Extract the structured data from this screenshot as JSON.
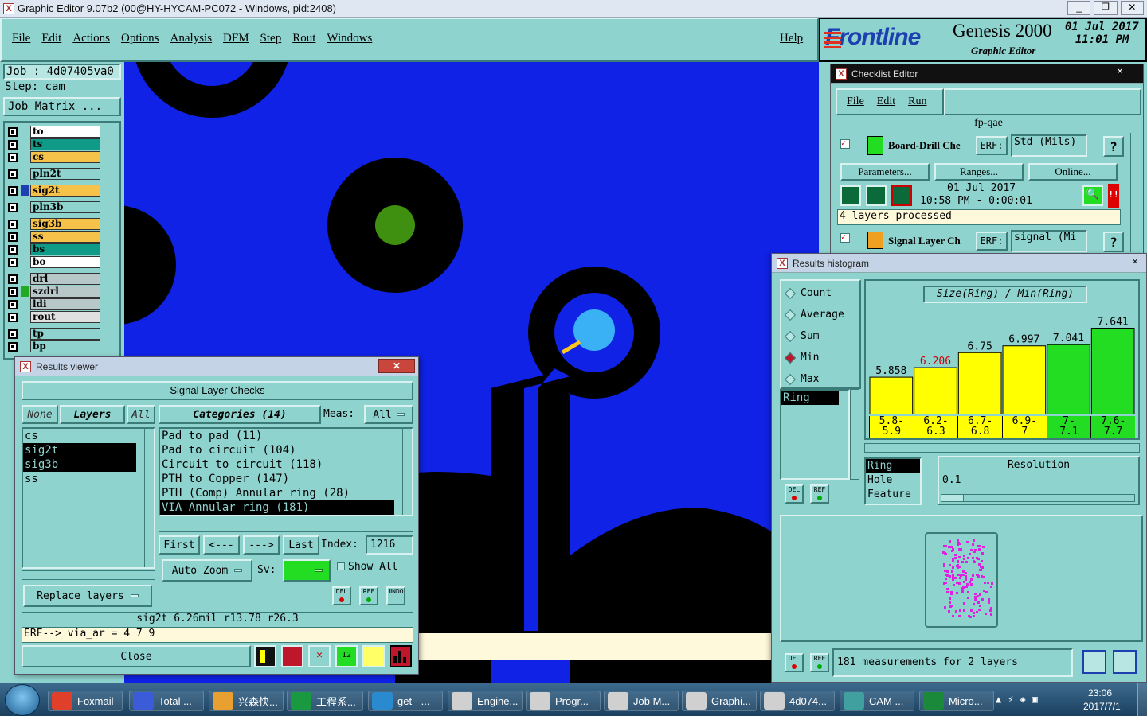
{
  "app": {
    "title": "Graphic Editor 9.07b2 (00@HY-HYCAM-PC072 - Windows, pid:2408)",
    "help": "Help"
  },
  "menu": [
    "File",
    "Edit",
    "Actions",
    "Options",
    "Analysis",
    "DFM",
    "Step",
    "Rout",
    "Windows"
  ],
  "brand": {
    "logo": "Frontline",
    "product": "Genesis 2000",
    "subtitle": "Graphic Editor",
    "date": "01 Jul 2017",
    "time": "11:01 PM"
  },
  "job": {
    "job": "Job : 4d07405va0",
    "step": "Step: cam",
    "matrix": "Job Matrix ..."
  },
  "layers": [
    {
      "name": "to",
      "color": "#ffffff"
    },
    {
      "name": "ts",
      "color": "#0f9b88"
    },
    {
      "name": "cs",
      "color": "#f7c24a"
    },
    {
      "name": "pln2t",
      "color": "#8fd3cf"
    },
    {
      "name": "sig2t",
      "color": "#f7c24a"
    },
    {
      "name": "pln3b",
      "color": "#8fd3cf"
    },
    {
      "name": "sig3b",
      "color": "#f7c24a"
    },
    {
      "name": "ss",
      "color": "#f7c24a"
    },
    {
      "name": "bs",
      "color": "#0f9b88"
    },
    {
      "name": "bo",
      "color": "#ffffff"
    },
    {
      "name": "drl",
      "color": "#b8c8c8"
    },
    {
      "name": "szdrl",
      "color": "#b8c8c8"
    },
    {
      "name": "ldi",
      "color": "#b8c8c8"
    },
    {
      "name": "rout",
      "color": "#e0e0e0"
    },
    {
      "name": "tp",
      "color": "#8fd3cf"
    },
    {
      "name": "bp",
      "color": "#8fd3cf"
    }
  ],
  "results_viewer": {
    "title": "Results viewer",
    "header": "Signal Layer Checks",
    "none": "None",
    "layers_label": "Layers",
    "all": "All",
    "categories_label": "Categories (14)",
    "meas_label": "Meas:",
    "meas_value": "All",
    "layer_list": [
      "cs",
      "sig2t",
      "sig3b",
      "ss"
    ],
    "categories": [
      "Pad to pad (11)",
      "Pad to circuit (104)",
      "Circuit to circuit (118)",
      "PTH to Copper (147)",
      "PTH (Comp) Annular ring (28)",
      "VIA Annular ring (181)"
    ],
    "first": "First",
    "prev": "<---",
    "next": "--->",
    "last": "Last",
    "index_label": "Index:",
    "index_value": "1216",
    "autozoom": "Auto Zoom",
    "sv_label": "Sv:",
    "show_all": "Show All",
    "replace": "Replace layers",
    "status": "sig2t  6.26mil  r13.78  r26.3",
    "erf": "ERF--> via_ar = 4 7 9",
    "close": "Close",
    "del": "DEL",
    "ref": "REF",
    "undo": "UNDO"
  },
  "checklist": {
    "title": "Checklist Editor",
    "menu": [
      "File",
      "Edit",
      "Run"
    ],
    "name": "fp-qae",
    "item1": "Board-Drill Che",
    "erf": "ERF:",
    "erf1": "Std (Mils)",
    "q": "?",
    "params": "Parameters...",
    "ranges": "Ranges...",
    "online": "Online...",
    "date": "01  Jul  2017",
    "time": "10:58  PM  -  0:00:01",
    "processed": "4 layers processed",
    "item2": "Signal Layer Ch",
    "erf2": "signal (Mi"
  },
  "histogram": {
    "title": "Results histogram",
    "modes": [
      "Count",
      "Average",
      "Sum",
      "Min",
      "Max"
    ],
    "selected_mode": "Min",
    "plot_title": "Size(Ring) / Min(Ring)",
    "list": [
      "Ring"
    ],
    "feature_list": [
      "Ring",
      "Hole",
      "Feature"
    ],
    "resolution_label": "Resolution",
    "resolution": "0.1",
    "footer": "181 measurements for 2 layers",
    "del": "DEL",
    "ref": "REF"
  },
  "chart_data": {
    "type": "bar",
    "categories": [
      "5.8-5.9",
      "6.2-6.3",
      "6.7-6.8",
      "6.9-7",
      "7-7.1",
      "7.6-7.7"
    ],
    "values": [
      5.858,
      6.206,
      6.75,
      6.997,
      7.041,
      7.641
    ],
    "colors": [
      "#ffff00",
      "#ffff00",
      "#ffff00",
      "#ffff00",
      "#22dd22",
      "#22dd22"
    ],
    "label_colors": [
      "#000000",
      "#d00000",
      "#000000",
      "#000000",
      "#000000",
      "#000000"
    ],
    "value_labels": [
      "5.858",
      "6.206",
      "6.75",
      "6.997",
      "7.041",
      "7.641"
    ],
    "bin_labels": [
      [
        "5.8-",
        "5.9"
      ],
      [
        "6.2-",
        "6.3"
      ],
      [
        "6.7-",
        "6.8"
      ],
      [
        "6.9-",
        "7"
      ],
      [
        "7-",
        "7.1"
      ],
      [
        "7.6-",
        "7.7"
      ]
    ],
    "title": "Size(Ring) / Min(Ring)"
  },
  "taskbar": {
    "items": [
      "Foxmail",
      "Total ...",
      "兴森快...",
      "工程系...",
      "get - ...",
      "Engine...",
      "Progr...",
      "Job M...",
      "Graphi...",
      "4d074...",
      "CAM ...",
      "Micro..."
    ],
    "time": "23:06",
    "date": "2017/7/1"
  }
}
